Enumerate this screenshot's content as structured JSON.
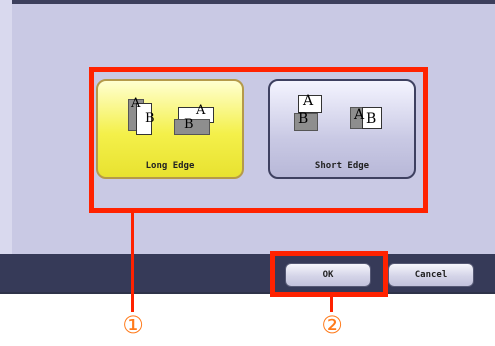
{
  "options": {
    "long_edge": {
      "label": "Long Edge",
      "selected": true,
      "icon": "long-edge-binding-icon"
    },
    "short_edge": {
      "label": "Short Edge",
      "selected": false,
      "icon": "short-edge-binding-icon"
    }
  },
  "icons": {
    "long_edge_letters": [
      "A",
      "B",
      "A",
      "B"
    ],
    "short_edge_letters": [
      "A",
      "B",
      "A",
      "B"
    ]
  },
  "actions": {
    "ok_label": "OK",
    "cancel_label": "Cancel"
  },
  "callouts": {
    "first": "①",
    "second": "②"
  },
  "colors": {
    "highlight": "#ff2200",
    "callout": "#ff7a1a",
    "selected_button": "#f4f04a",
    "panel": "#c9c9e4",
    "bar": "#363a58"
  }
}
